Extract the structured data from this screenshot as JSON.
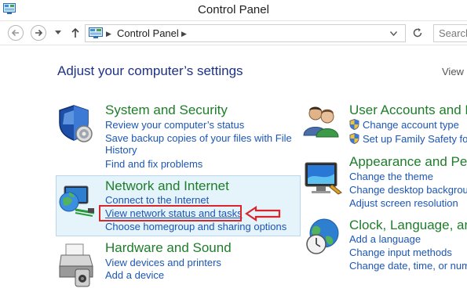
{
  "window": {
    "title": "Control Panel"
  },
  "address_bar": {
    "location": "Control Panel",
    "search_placeholder": "Search"
  },
  "page": {
    "heading": "Adjust your computer’s settings",
    "view_by_label": "View"
  },
  "categories_left": [
    {
      "title": "System and Security",
      "icon": "shield-icon",
      "links": [
        "Review your computer’s status",
        "Save backup copies of your files with File",
        "History",
        "Find and fix problems"
      ]
    },
    {
      "title": "Network and Internet",
      "icon": "network-globe-icon",
      "links": [
        "Connect to the Internet",
        "View network status and tasks",
        "Choose homegroup and sharing options"
      ]
    },
    {
      "title": "Hardware and Sound",
      "icon": "printer-icon",
      "links": [
        "View devices and printers",
        "Add a device"
      ]
    }
  ],
  "categories_right": [
    {
      "title": "User Accounts and Fa",
      "icon": "users-icon",
      "links": [
        "Change account type",
        "Set up Family Safety for a"
      ]
    },
    {
      "title": "Appearance and Pers",
      "icon": "display-icon",
      "links": [
        "Change the theme",
        "Change desktop backgroun",
        "Adjust screen resolution"
      ]
    },
    {
      "title": "Clock, Language, and",
      "icon": "clock-globe-icon",
      "links": [
        "Add a language",
        "Change input methods",
        "Change date, time, or num"
      ]
    }
  ],
  "colors": {
    "category_title": "#1e7d2a",
    "link": "#1c56b5",
    "heading": "#1e3287",
    "highlight_box": "#e5f3fb",
    "callout": "#d9262c"
  }
}
